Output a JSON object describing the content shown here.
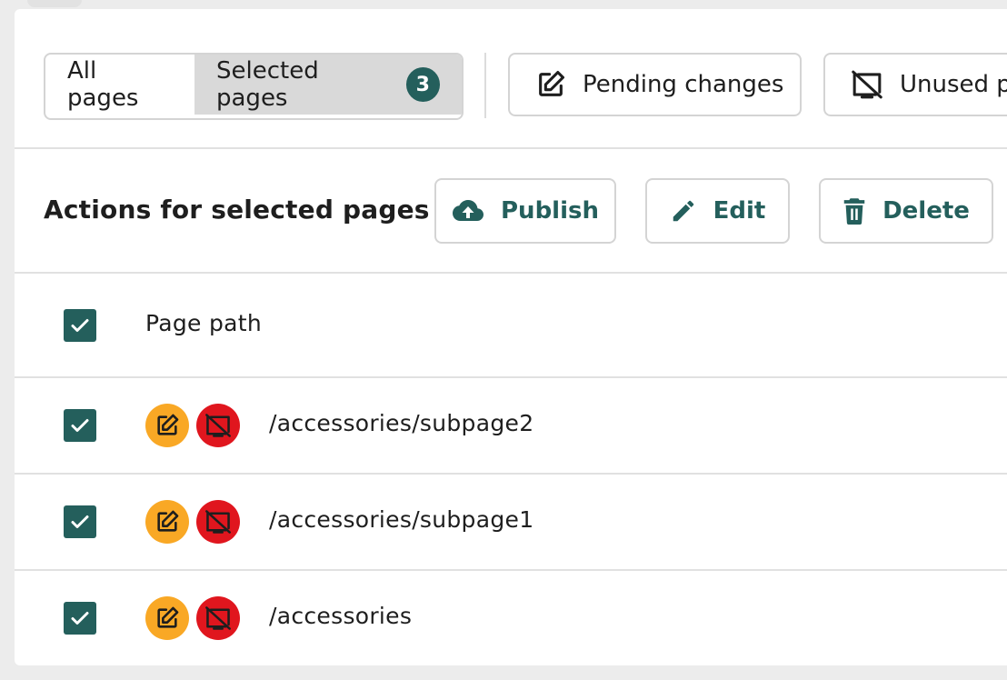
{
  "toolbar": {
    "tabs": [
      {
        "label": "All pages",
        "selected": false
      },
      {
        "label": "Selected pages",
        "selected": true,
        "count": "3"
      }
    ],
    "filters": [
      {
        "label": "Pending changes",
        "icon": "edit-square-icon"
      },
      {
        "label": "Unused pages",
        "icon": "unused-screen-icon"
      }
    ]
  },
  "actions": {
    "title": "Actions for selected pages",
    "buttons": [
      {
        "label": "Publish",
        "icon": "cloud-upload-icon"
      },
      {
        "label": "Edit",
        "icon": "pencil-icon"
      },
      {
        "label": "Delete",
        "icon": "trash-icon"
      }
    ]
  },
  "table": {
    "header": {
      "column": "Page path",
      "checked": true
    },
    "rows": [
      {
        "path": "/accessories/subpage2",
        "checked": true,
        "pending": true,
        "unused": true
      },
      {
        "path": "/accessories/subpage1",
        "checked": true,
        "pending": true,
        "unused": true
      },
      {
        "path": "/accessories",
        "checked": true,
        "pending": true,
        "unused": true
      }
    ]
  },
  "colors": {
    "accent": "#245f5c",
    "pending_badge": "#f9a825",
    "unused_badge": "#e0161e",
    "selected_tab_bg": "#d9d9d9"
  }
}
